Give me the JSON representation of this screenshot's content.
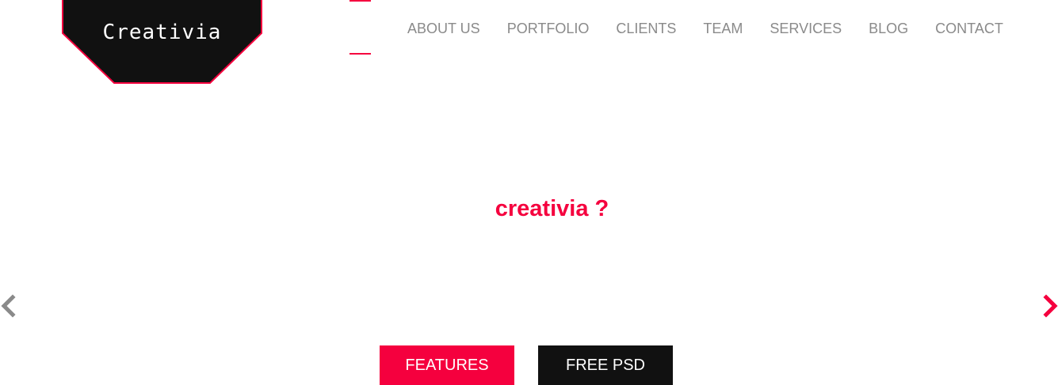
{
  "brand": {
    "logo_text": "Creativia",
    "accent_color": "#f5003e",
    "dark_color": "#111111"
  },
  "nav": {
    "items": [
      {
        "label": "ABOUT US"
      },
      {
        "label": "PORTFOLIO"
      },
      {
        "label": "CLIENTS"
      },
      {
        "label": "TEAM"
      },
      {
        "label": "SERVICES"
      },
      {
        "label": "BLOG"
      },
      {
        "label": "CONTACT"
      }
    ]
  },
  "hero": {
    "title": "creativia ?",
    "prev_icon": "chevron-left-icon",
    "next_icon": "chevron-right-icon"
  },
  "buttons": {
    "features_label": "FEATURES",
    "psd_label": "FREE PSD"
  }
}
